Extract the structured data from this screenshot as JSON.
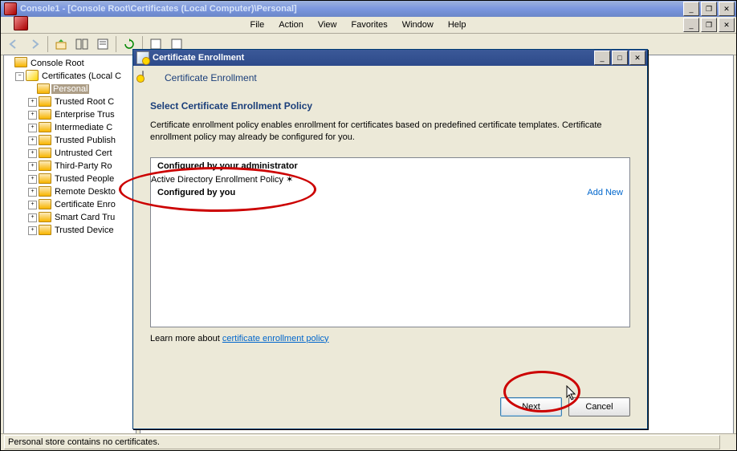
{
  "main": {
    "title": "Console1 - [Console Root\\Certificates (Local Computer)\\Personal]",
    "menu": [
      "File",
      "Action",
      "View",
      "Favorites",
      "Window",
      "Help"
    ],
    "status": "Personal store contains no certificates."
  },
  "tree": {
    "root": "Console Root",
    "certs": "Certificates (Local C",
    "items": [
      "Personal",
      "Trusted Root C",
      "Enterprise Trus",
      "Intermediate C",
      "Trusted Publish",
      "Untrusted Cert",
      "Third-Party Ro",
      "Trusted People",
      "Remote Deskto",
      "Certificate Enro",
      "Smart Card Tru",
      "Trusted Device"
    ]
  },
  "dialog": {
    "title": "Certificate Enrollment",
    "header": "Certificate Enrollment",
    "section_title": "Select Certificate Enrollment Policy",
    "section_desc": "Certificate enrollment policy enables enrollment for certificates based on predefined certificate templates. Certificate enrollment policy may already be configured for you.",
    "group1": "Configured by your administrator",
    "row1": "Active Directory Enrollment Policy",
    "group2": "Configured by you",
    "addnew": "Add New",
    "learn_prefix": "Learn more about ",
    "learn_link": "certificate enrollment policy",
    "next": "Next",
    "cancel": "Cancel"
  }
}
